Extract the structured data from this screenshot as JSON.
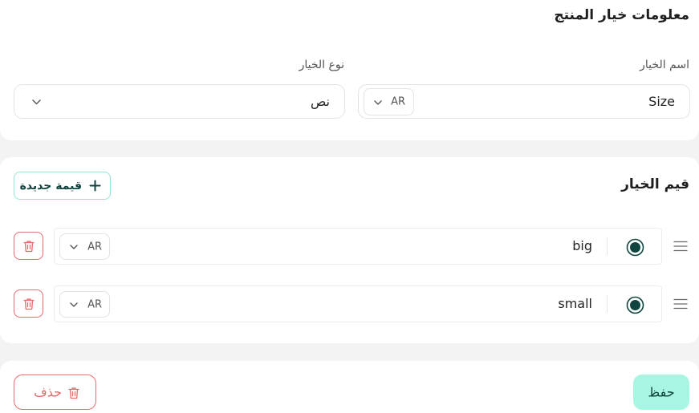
{
  "product_option_info": {
    "title": "معلومات خيار المنتج",
    "option_name": {
      "label": "اسم الخيار",
      "value": "Size",
      "language": "AR"
    },
    "option_type": {
      "label": "نوع الخيار",
      "value": "نص"
    }
  },
  "option_values": {
    "title": "قيم الخيار",
    "add_button_label": "قيمة جديدة",
    "items": [
      {
        "value": "big",
        "language": "AR",
        "selected": true
      },
      {
        "value": "small",
        "language": "AR",
        "selected": true
      }
    ]
  },
  "actions": {
    "save_label": "حفظ",
    "delete_label": "حذف"
  },
  "colors": {
    "accent": "#a8f5e3",
    "accent_border": "#8fe7d7",
    "dark_teal": "#10443f",
    "danger": "#e36a6a",
    "background": "#f3f3f3"
  },
  "icons": {
    "add": "plus-icon",
    "delete": "trash-icon",
    "reorder": "drag-handle-icon",
    "dropdown": "chevron-down-icon",
    "selected": "radio-selected-icon"
  }
}
